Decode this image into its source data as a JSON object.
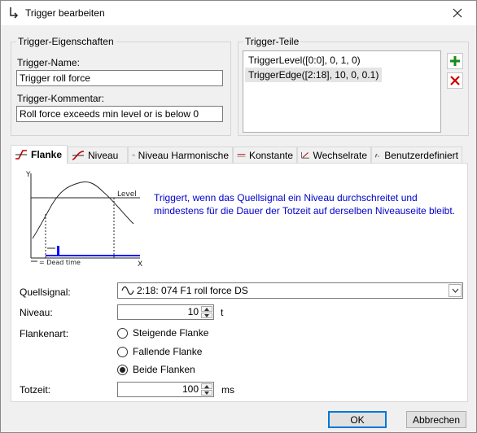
{
  "window": {
    "title": "Trigger bearbeiten"
  },
  "properties": {
    "group_label": "Trigger-Eigenschaften",
    "name_label": "Trigger-Name:",
    "name_value": "Trigger roll force",
    "comment_label": "Trigger-Kommentar:",
    "comment_value": "Roll force exceeds min level or is below 0"
  },
  "parts": {
    "group_label": "Trigger-Teile",
    "items": [
      "TriggerLevel([0:0], 0, 1, 0)",
      "TriggerEdge([2:18], 10, 0, 0.1)"
    ]
  },
  "tabs": [
    {
      "label": "Flanke",
      "icon": "edge-icon"
    },
    {
      "label": "Niveau",
      "icon": "level-icon"
    },
    {
      "label": "Niveau Harmonische",
      "icon": "level-harmonic-icon"
    },
    {
      "label": "Konstante",
      "icon": "constant-icon"
    },
    {
      "label": "Wechselrate",
      "icon": "change-rate-icon"
    },
    {
      "label": "Benutzerdefiniert",
      "icon": "function-icon"
    }
  ],
  "diagram": {
    "y_label": "Y",
    "x_label": "X",
    "level_label": "Level",
    "legend": "= Dead time"
  },
  "description": "Triggert, wenn das Quellsignal ein Niveau durchschreitet und mindestens für die Dauer der Totzeit auf derselben Niveauseite bleibt.",
  "form": {
    "source_label": "Quellsignal:",
    "source_value": "2:18: 074 F1 roll force DS",
    "level_label": "Niveau:",
    "level_value": "10",
    "level_unit": "t",
    "edge_type_label": "Flankenart:",
    "edge_options": [
      "Steigende Flanke",
      "Fallende Flanke",
      "Beide Flanken"
    ],
    "edge_selected": "Beide Flanken",
    "deadtime_label": "Totzeit:",
    "deadtime_value": "100",
    "deadtime_unit": "ms"
  },
  "buttons": {
    "ok": "OK",
    "cancel": "Abbrechen"
  },
  "colors": {
    "accent": "#0078d7",
    "add": "#1a8a1a",
    "remove": "#d00000",
    "description": "#0000cc",
    "marker": "#0000ff"
  }
}
